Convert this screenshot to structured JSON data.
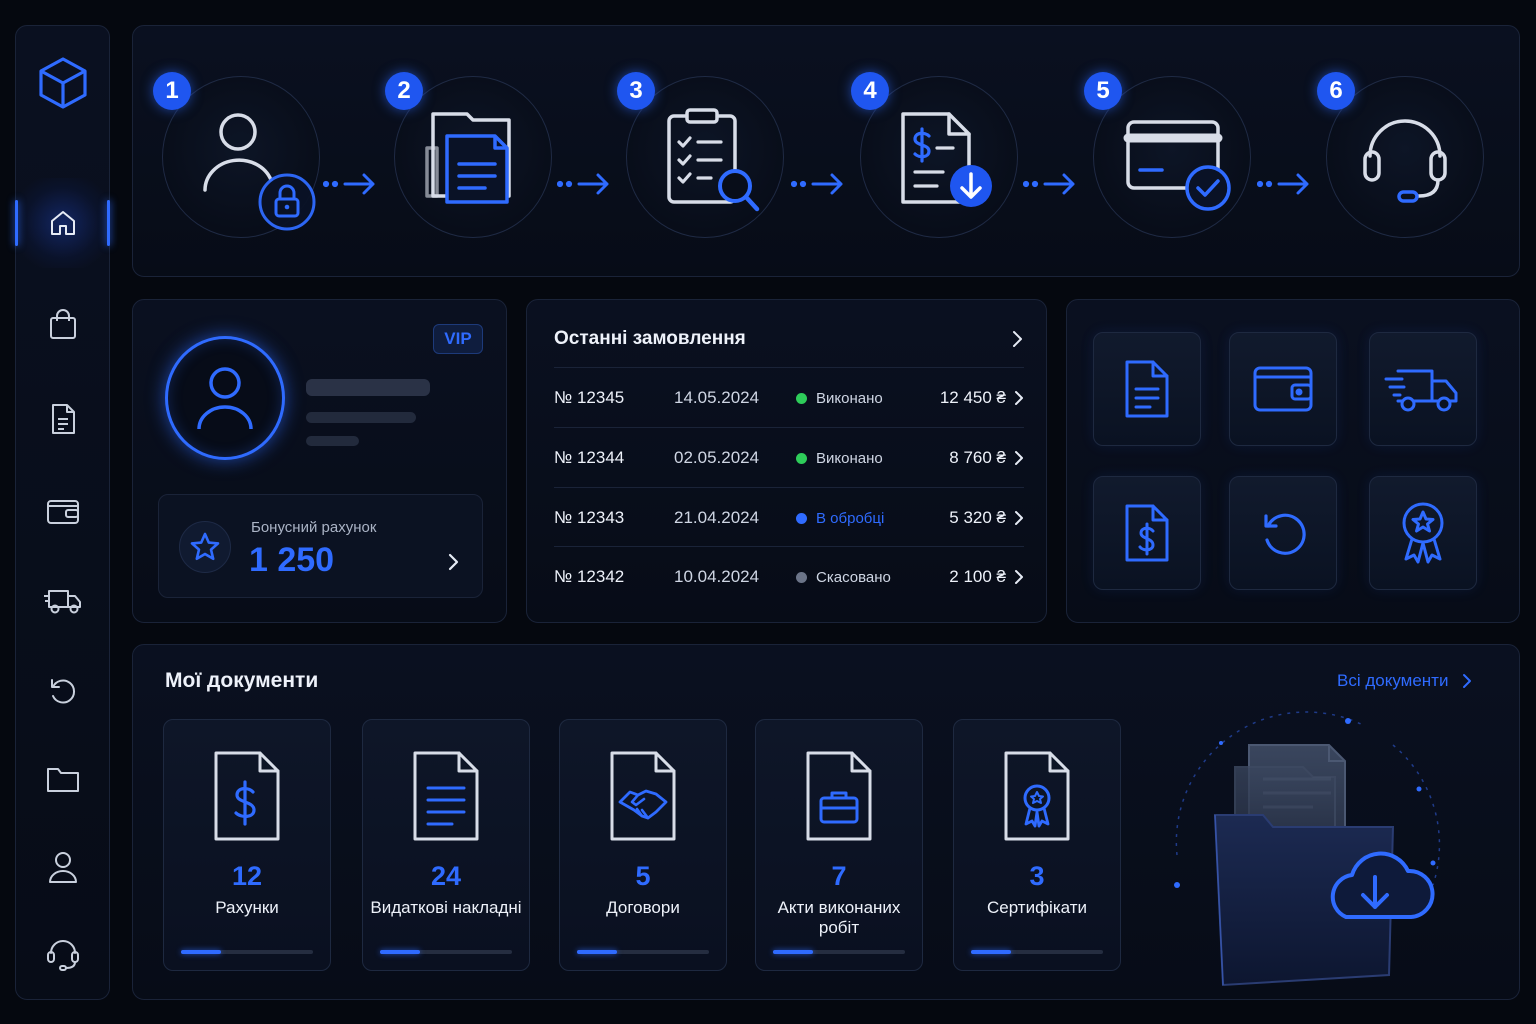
{
  "steps": [
    {
      "number": "1",
      "icon": "user-lock-icon"
    },
    {
      "number": "2",
      "icon": "documents-icon"
    },
    {
      "number": "3",
      "icon": "checklist-search-icon"
    },
    {
      "number": "4",
      "icon": "invoice-download-icon"
    },
    {
      "number": "5",
      "icon": "card-check-icon"
    },
    {
      "number": "6",
      "icon": "headset-icon"
    }
  ],
  "sidebar": {
    "logo": "cube-icon",
    "items": [
      {
        "icon": "home-icon",
        "active": true
      },
      {
        "icon": "shopping-bag-icon"
      },
      {
        "icon": "document-icon"
      },
      {
        "icon": "wallet-icon"
      },
      {
        "icon": "truck-icon"
      },
      {
        "icon": "return-icon"
      },
      {
        "icon": "folder-icon"
      },
      {
        "icon": "user-icon"
      },
      {
        "icon": "headset-icon"
      }
    ]
  },
  "profile": {
    "badge": "VIP",
    "bonus_label": "Бонусний рахунок",
    "bonus_value": "1 250"
  },
  "orders": {
    "title": "Останні замовлення",
    "rows": [
      {
        "number": "№ 12345",
        "date": "14.05.2024",
        "status": "Виконано",
        "amount": "12 450 ₴"
      },
      {
        "number": "№ 12344",
        "date": "02.05.2024",
        "status": "Виконано",
        "amount": "8 760 ₴"
      },
      {
        "number": "№ 12343",
        "date": "21.04.2024",
        "status": "В обробці",
        "amount": "5 320 ₴"
      },
      {
        "number": "№ 12342",
        "date": "10.04.2024",
        "status": "Скасовано",
        "amount": "2 100 ₴"
      }
    ]
  },
  "quick_actions": [
    {
      "icon": "document-icon"
    },
    {
      "icon": "wallet-icon"
    },
    {
      "icon": "truck-icon"
    },
    {
      "icon": "invoice-dollar-icon"
    },
    {
      "icon": "return-icon"
    },
    {
      "icon": "award-icon"
    }
  ],
  "documents": {
    "title": "Мої документи",
    "all_link": "Всі документи",
    "cards": [
      {
        "count": "12",
        "label": "Рахунки",
        "icon": "invoice-dollar-icon",
        "progress": 0.3
      },
      {
        "count": "24",
        "label": "Видаткові накладні",
        "icon": "document-lines-icon",
        "progress": 0.3
      },
      {
        "count": "5",
        "label": "Договори",
        "icon": "handshake-document-icon",
        "progress": 0.3
      },
      {
        "count": "7",
        "label": "Акти виконаних робіт",
        "icon": "briefcase-document-icon",
        "progress": 0.3
      },
      {
        "count": "3",
        "label": "Сертифікати",
        "icon": "certificate-document-icon",
        "progress": 0.3
      }
    ]
  },
  "colors": {
    "accent": "#2f6bff",
    "done": "#2ecc5a",
    "processing": "#2f6bff",
    "cancelled": "#6b7488"
  }
}
